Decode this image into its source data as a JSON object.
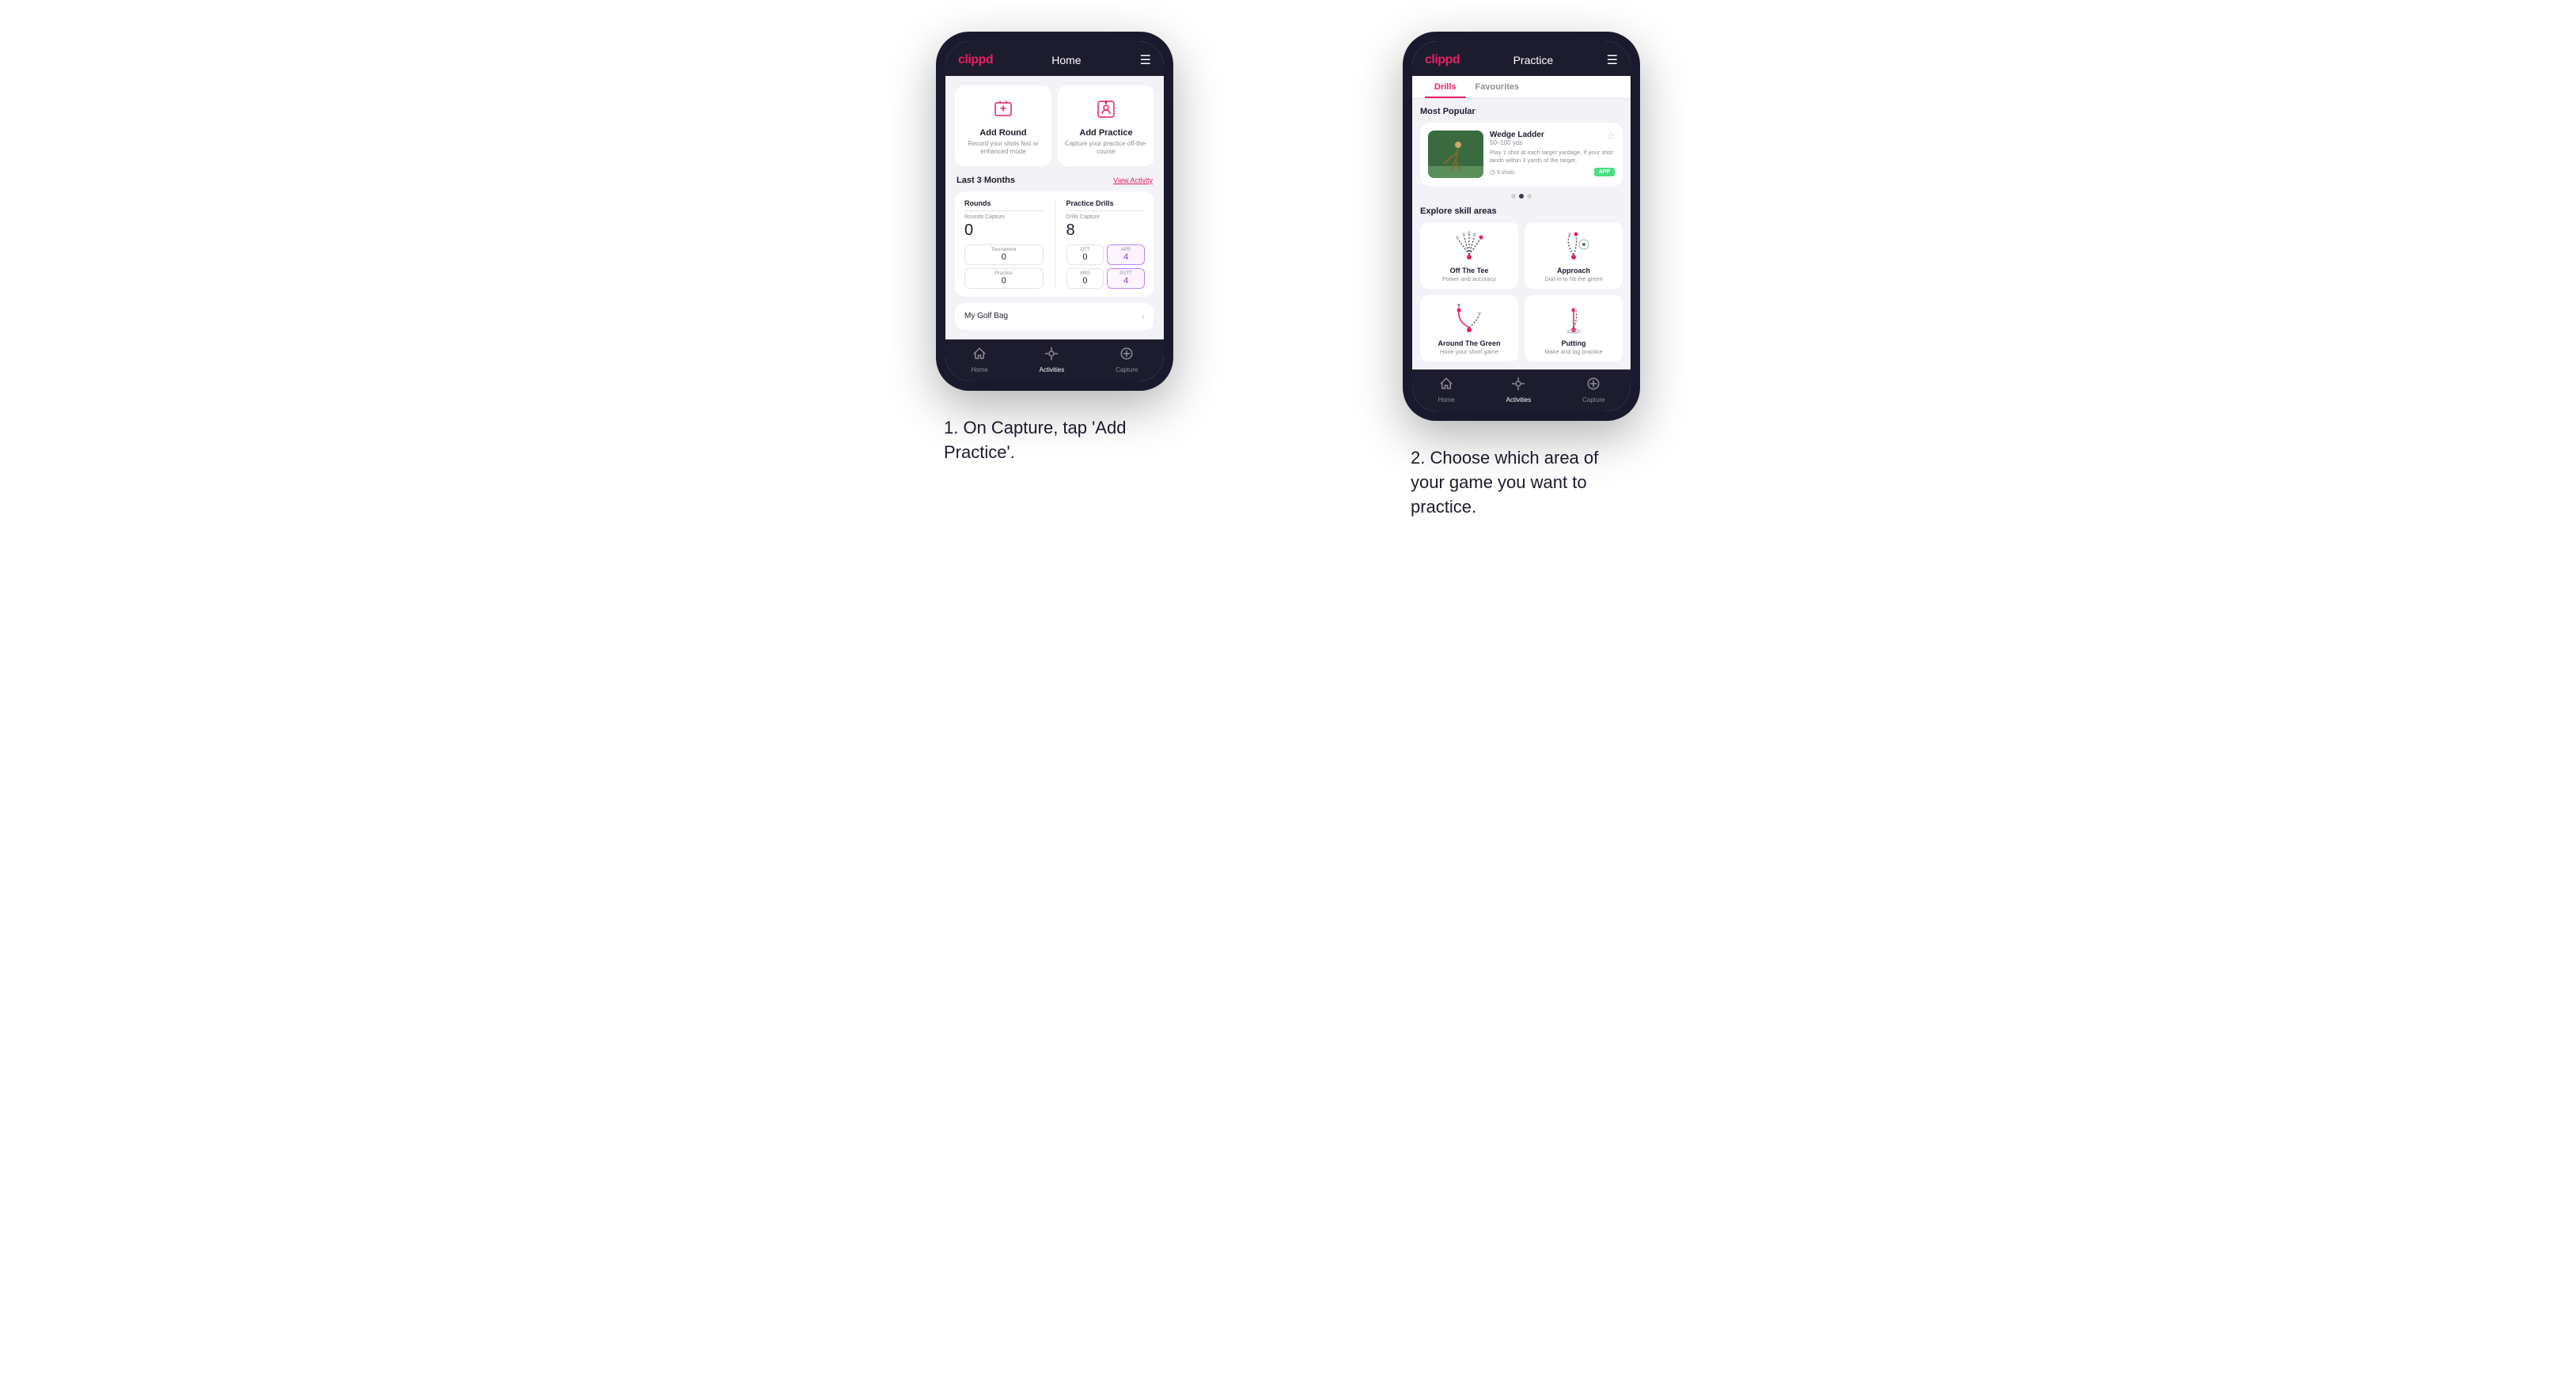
{
  "phone1": {
    "header": {
      "logo": "clippd",
      "title": "Home",
      "menu_icon": "☰"
    },
    "add_round": {
      "title": "Add Round",
      "desc": "Record your shots fast or enhanced mode"
    },
    "add_practice": {
      "title": "Add Practice",
      "desc": "Capture your practice off-the-course"
    },
    "last_months": {
      "label": "Last 3 Months",
      "link": "View Activity"
    },
    "rounds_section": {
      "title": "Rounds",
      "capture_label": "Rounds Capture",
      "total": "0",
      "tournament_label": "Tournament",
      "tournament_value": "0",
      "practice_label": "Practice",
      "practice_value": "0"
    },
    "drills_section": {
      "title": "Practice Drills",
      "capture_label": "Drills Capture",
      "total": "8",
      "ott_label": "OTT",
      "ott_value": "0",
      "app_label": "APP",
      "app_value": "4",
      "arg_label": "ARG",
      "arg_value": "0",
      "putt_label": "PUTT",
      "putt_value": "4"
    },
    "golf_bag": {
      "label": "My Golf Bag"
    },
    "nav": {
      "items": [
        {
          "icon": "⌂",
          "label": "Home",
          "active": false
        },
        {
          "icon": "◎",
          "label": "Activities",
          "active": true
        },
        {
          "icon": "⊕",
          "label": "Capture",
          "active": false
        }
      ]
    }
  },
  "phone2": {
    "header": {
      "logo": "clippd",
      "title": "Practice",
      "menu_icon": "☰"
    },
    "tabs": [
      {
        "label": "Drills",
        "active": true
      },
      {
        "label": "Favourites",
        "active": false
      }
    ],
    "most_popular_label": "Most Popular",
    "featured": {
      "title": "Wedge Ladder",
      "yds": "50–100 yds",
      "desc": "Play 1 shot at each target yardage. If your shot lands within 3 yards of the target..",
      "shots": "9 shots",
      "badge": "APP"
    },
    "dots": [
      {
        "active": false
      },
      {
        "active": true
      },
      {
        "active": false
      }
    ],
    "explore_label": "Explore skill areas",
    "skills": [
      {
        "title": "Off The Tee",
        "desc": "Power and accuracy",
        "icon_type": "ott"
      },
      {
        "title": "Approach",
        "desc": "Dial-in to hit the green",
        "icon_type": "approach"
      },
      {
        "title": "Around The Green",
        "desc": "Hone your short game",
        "icon_type": "atg"
      },
      {
        "title": "Putting",
        "desc": "Make and lag practice",
        "icon_type": "putting"
      }
    ],
    "nav": {
      "items": [
        {
          "icon": "⌂",
          "label": "Home",
          "active": false
        },
        {
          "icon": "◎",
          "label": "Activities",
          "active": true
        },
        {
          "icon": "⊕",
          "label": "Capture",
          "active": false
        }
      ]
    }
  },
  "captions": {
    "step1": "1. On Capture, tap 'Add Practice'.",
    "step2": "2. Choose which area of your game you want to practice."
  }
}
